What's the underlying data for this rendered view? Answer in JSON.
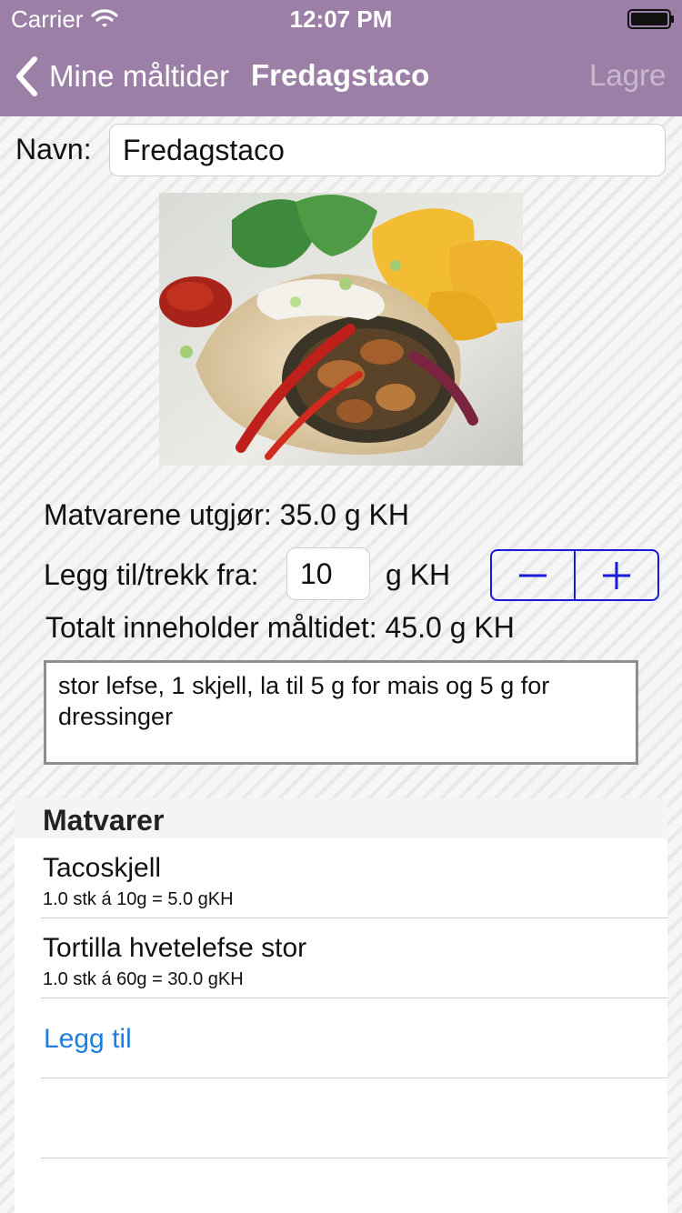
{
  "status_bar": {
    "carrier": "Carrier",
    "time": "12:07 PM"
  },
  "nav": {
    "back_label": "Mine måltider",
    "title": "Fredagstaco",
    "save_label": "Lagre",
    "bar_color": "#9c7fa6"
  },
  "form": {
    "name_label": "Navn:",
    "name_value": "Fredagstaco",
    "carb_sum": "Matvarene utgjør: 35.0 g KH",
    "adjust_label": "Legg til/trekk fra:",
    "adjust_value": "10",
    "adjust_unit": "g KH",
    "total": "Totalt inneholder måltidet: 45.0 g KH",
    "notes": "stor lefse, 1 skjell, la til 5 g for mais og 5 g for\ndressinger"
  },
  "foods": {
    "header": "Matvarer",
    "items": [
      {
        "name": "Tacoskjell",
        "detail": "1.0 stk á 10g = 5.0 gKH"
      },
      {
        "name": "Tortilla hvetelefse stor",
        "detail": "1.0 stk á 60g = 30.0 gKH"
      }
    ],
    "add_label": "Legg til",
    "link_color": "#1e7ee0"
  },
  "icons": {
    "back": "chevron-left-icon",
    "wifi": "wifi-icon",
    "battery": "battery-icon",
    "minus": "minus-icon",
    "plus": "plus-icon"
  }
}
